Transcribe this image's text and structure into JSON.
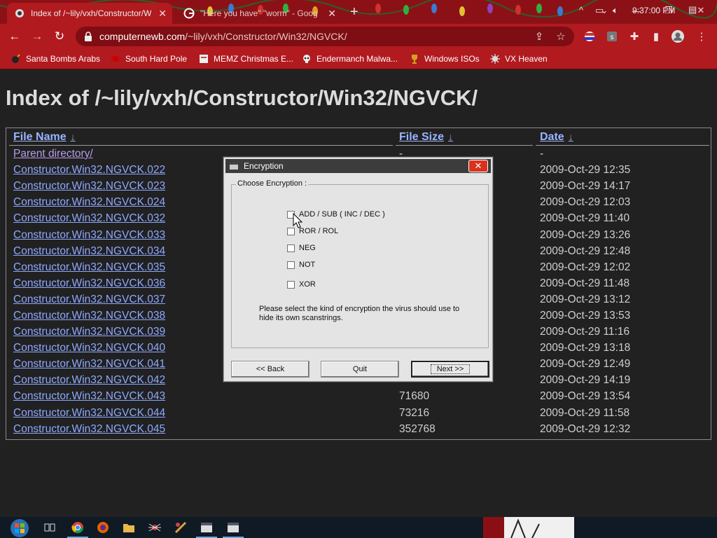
{
  "browser": {
    "tabs": [
      {
        "title": "Index of /~lily/vxh/Constructor/W",
        "active": true
      },
      {
        "title": "\"Here you have\" \"worm\" - Goog",
        "active": false
      }
    ],
    "url_host": "computernewb.com",
    "url_path": "/~lily/vxh/Constructor/Win32/NGVCK/",
    "bookmarks": [
      {
        "label": "Santa Bombs Arabs",
        "icon": "bomb-icon"
      },
      {
        "label": "South Hard Pole",
        "icon": "spider-icon"
      },
      {
        "label": "MEMZ Christmas E...",
        "icon": "page-icon"
      },
      {
        "label": "Endermanch Malwa...",
        "icon": "skull-icon"
      },
      {
        "label": "Windows ISOs",
        "icon": "trophy-icon"
      },
      {
        "label": "VX Heaven",
        "icon": "virus-icon"
      }
    ],
    "accent": "#b11a1f"
  },
  "page": {
    "heading": "Index of /~lily/vxh/Constructor/Win32/NGVCK/",
    "columns": {
      "name": "File Name",
      "size": "File Size",
      "date": "Date",
      "sort_arrow": "↓"
    },
    "rows": [
      {
        "name": "Parent directory/",
        "size": "-",
        "date": "-"
      },
      {
        "name": "Constructor.Win32.NGVCK.022",
        "size": "",
        "date": "2009-Oct-29 12:35"
      },
      {
        "name": "Constructor.Win32.NGVCK.023",
        "size": "",
        "date": "2009-Oct-29 14:17"
      },
      {
        "name": "Constructor.Win32.NGVCK.024",
        "size": "",
        "date": "2009-Oct-29 12:03"
      },
      {
        "name": "Constructor.Win32.NGVCK.032",
        "size": "",
        "date": "2009-Oct-29 11:40"
      },
      {
        "name": "Constructor.Win32.NGVCK.033",
        "size": "",
        "date": "2009-Oct-29 13:26"
      },
      {
        "name": "Constructor.Win32.NGVCK.034",
        "size": "",
        "date": "2009-Oct-29 12:48"
      },
      {
        "name": "Constructor.Win32.NGVCK.035",
        "size": "",
        "date": "2009-Oct-29 12:02"
      },
      {
        "name": "Constructor.Win32.NGVCK.036",
        "size": "",
        "date": "2009-Oct-29 11:48"
      },
      {
        "name": "Constructor.Win32.NGVCK.037",
        "size": "",
        "date": "2009-Oct-29 13:12"
      },
      {
        "name": "Constructor.Win32.NGVCK.038",
        "size": "",
        "date": "2009-Oct-29 13:53"
      },
      {
        "name": "Constructor.Win32.NGVCK.039",
        "size": "",
        "date": "2009-Oct-29 11:16"
      },
      {
        "name": "Constructor.Win32.NGVCK.040",
        "size": "",
        "date": "2009-Oct-29 13:18"
      },
      {
        "name": "Constructor.Win32.NGVCK.041",
        "size": "",
        "date": "2009-Oct-29 12:49"
      },
      {
        "name": "Constructor.Win32.NGVCK.042",
        "size": "",
        "date": "2009-Oct-29 14:19"
      },
      {
        "name": "Constructor.Win32.NGVCK.043",
        "size": "71680",
        "date": "2009-Oct-29 13:54"
      },
      {
        "name": "Constructor.Win32.NGVCK.044",
        "size": "73216",
        "date": "2009-Oct-29 11:58"
      },
      {
        "name": "Constructor.Win32.NGVCK.045",
        "size": "352768",
        "date": "2009-Oct-29 12:32"
      }
    ]
  },
  "dialog": {
    "title": "Encryption",
    "close": "✕",
    "group_label": "Choose Encryption :",
    "options": [
      {
        "label": "ADD / SUB ( INC / DEC )",
        "checked": false
      },
      {
        "label": "ROR / ROL",
        "checked": false
      },
      {
        "label": "NEG",
        "checked": false
      },
      {
        "label": "NOT",
        "checked": false
      },
      {
        "label": "XOR",
        "checked": false
      }
    ],
    "description": "Please select the kind of encryption the virus should use to hide its own scanstrings.",
    "buttons": {
      "back": "<< Back",
      "quit": "Quit",
      "next": "Next >>"
    }
  },
  "taskbar": {
    "clock": "9:37:00 PM",
    "bg": "#0f1a25"
  }
}
